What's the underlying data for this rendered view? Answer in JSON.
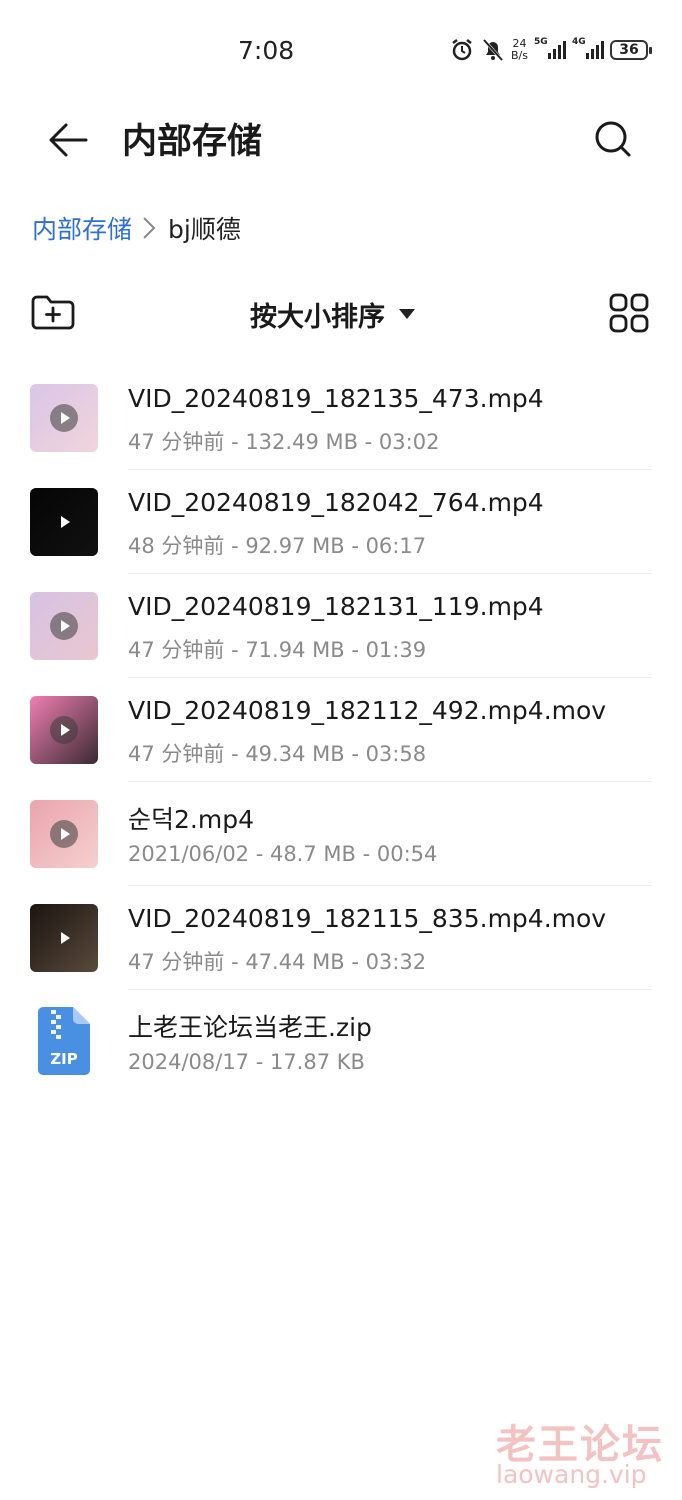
{
  "status_bar": {
    "time": "7:08",
    "net_speed_value": "24",
    "net_speed_unit": "B/s",
    "sim1_label": "5G",
    "sim2_label": "4G",
    "battery": "36",
    "icons": [
      "alarm-icon",
      "mute-icon",
      "signal-5g-icon",
      "signal-4g-icon",
      "battery-icon"
    ]
  },
  "header": {
    "title": "内部存储",
    "back_icon": "arrow-left-icon",
    "search_icon": "search-icon"
  },
  "breadcrumb": {
    "root": "内部存储",
    "current": "bj顺德"
  },
  "toolbar": {
    "sort_label": "按大小排序",
    "new_folder_icon": "folder-add-icon",
    "grid_icon": "grid-view-icon"
  },
  "files": [
    {
      "name": "VID_20240819_182135_473.mp4",
      "meta": "47 分钟前 - 132.49 MB - 03:02",
      "type": "video",
      "thumb_colors": [
        "#d9c6e6",
        "#f2d4dc"
      ]
    },
    {
      "name": "VID_20240819_182042_764.mp4",
      "meta": "48 分钟前 - 92.97 MB - 06:17",
      "type": "video",
      "thumb_colors": [
        "#050505",
        "#111111"
      ]
    },
    {
      "name": "VID_20240819_182131_119.mp4",
      "meta": "47 分钟前 - 71.94 MB - 01:39",
      "type": "video",
      "thumb_colors": [
        "#d7c2e4",
        "#e9c7cf"
      ]
    },
    {
      "name": "VID_20240819_182112_492.mp4.mov",
      "meta": "47 分钟前 - 49.34 MB - 03:58",
      "type": "video",
      "thumb_colors": [
        "#f07fb4",
        "#3a2a30"
      ]
    },
    {
      "name": "순덕2.mp4",
      "meta": "2021/06/02 - 48.7 MB - 00:54",
      "type": "video",
      "thumb_colors": [
        "#e9a4ad",
        "#f6d0cf"
      ]
    },
    {
      "name": "VID_20240819_182115_835.mp4.mov",
      "meta": "47 分钟前 - 47.44 MB - 03:32",
      "type": "video",
      "thumb_colors": [
        "#1b1410",
        "#5a4a3c"
      ]
    },
    {
      "name": "上老王论坛当老王.zip",
      "meta": "2024/08/17 - 17.87 KB",
      "type": "zip",
      "icon_label": "ZIP",
      "icon_color": "#4a90e2"
    }
  ],
  "watermark": {
    "cn": "老王论坛",
    "en": "laowang.vip"
  }
}
